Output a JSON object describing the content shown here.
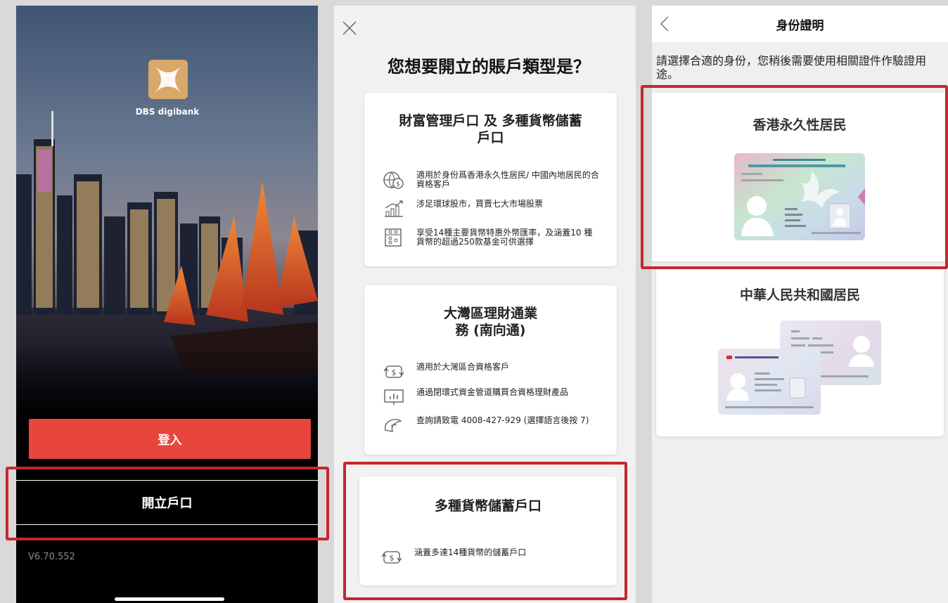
{
  "login_screen": {
    "brand_name": "DBS digibank",
    "login_label": "登入",
    "open_account_label": "開立戶口",
    "version": "V6.70.552"
  },
  "account_type_screen": {
    "question": "您想要開立的賬戶類型是？",
    "cards": [
      {
        "title": "財富管理戶口 及 多種貨幣儲蓄戶口",
        "features": [
          {
            "icon": "globe-dollar-icon",
            "text": "適用於身份爲香港永久性居民/ 中國內地居民的合資格客戶"
          },
          {
            "icon": "growth-chart-icon",
            "text": "涉足環球股市，買賣七大市場股票"
          },
          {
            "icon": "abacus-icon",
            "text": "享受14種主要貨幣特惠外幣匯率，及涵蓋10 種貨幣的超過250款基金可供選擇"
          }
        ]
      },
      {
        "title": "大灣區理財通業務 (南向通)",
        "features": [
          {
            "icon": "currency-exchange-icon",
            "text": "適用於大灣區合資格客戶"
          },
          {
            "icon": "presentation-chart-icon",
            "text": "通過閉環式資金管道購買合資格理財產品"
          },
          {
            "icon": "phone-hand-icon",
            "text": "查詢請致電 4008-427-929 (選擇語言後按 7)"
          }
        ]
      },
      {
        "title": "多種貨幣儲蓄戶口",
        "features": [
          {
            "icon": "currency-exchange-icon",
            "text": "涵蓋多達14種貨幣的儲蓄戶口"
          }
        ]
      }
    ]
  },
  "identity_screen": {
    "title": "身份證明",
    "description": "請選擇合適的身份，您稍後需要使用相關證件作驗證用途。",
    "options": [
      {
        "label": "香港永久性居民"
      },
      {
        "label": "中華人民共和國居民"
      }
    ]
  },
  "colors": {
    "brand_red": "#e8453c",
    "highlight": "#c6272e",
    "logo_gold": "#d9a86a"
  }
}
